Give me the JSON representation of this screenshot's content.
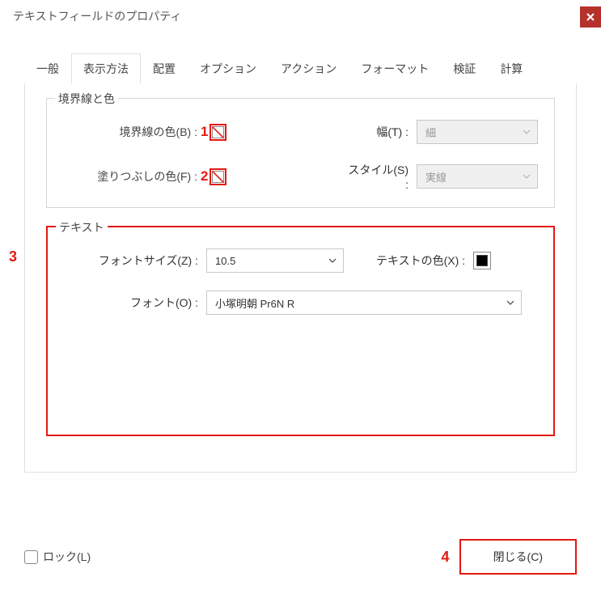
{
  "title": "テキストフィールドのプロパティ",
  "tabs": [
    "一般",
    "表示方法",
    "配置",
    "オプション",
    "アクション",
    "フォーマット",
    "検証",
    "計算"
  ],
  "activeTab": 1,
  "borderSection": {
    "legend": "境界線と色",
    "borderColorLabel": "境界線の色(B) :",
    "fillColorLabel": "塗りつぶしの色(F) :",
    "widthLabel": "幅(T) :",
    "styleLabel": "スタイル(S) :",
    "widthValue": "細",
    "styleValue": "実線"
  },
  "textSection": {
    "legend": "テキスト",
    "fontSizeLabel": "フォントサイズ(Z) :",
    "fontSizeValue": "10.5",
    "textColorLabel": "テキストの色(X) :",
    "fontLabel": "フォント(O) :",
    "fontValue": "小塚明朝 Pr6N R"
  },
  "lockLabel": "ロック(L)",
  "closeLabel": "閉じる(C)",
  "markers": {
    "m1": "1",
    "m2": "2",
    "m3": "3",
    "m4": "4"
  }
}
